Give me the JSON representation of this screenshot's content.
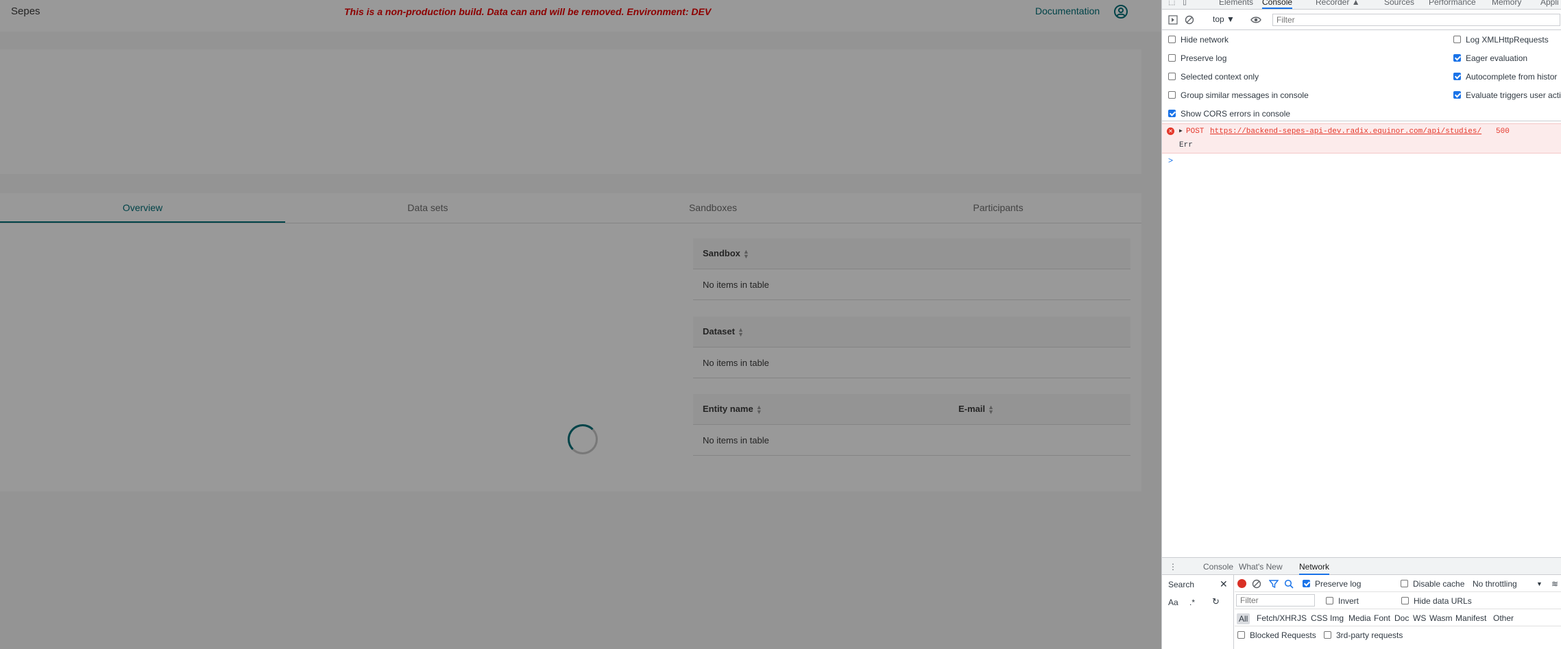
{
  "app": {
    "brand": "Sepes",
    "env_warning": "This is a non-production build. Data can and will be removed. Environment: DEV",
    "documentation_link": "Documentation",
    "tabs": [
      "Overview",
      "Data sets",
      "Sandboxes",
      "Participants"
    ],
    "active_tab": "Overview",
    "tables": [
      {
        "columns": [
          "Sandbox"
        ],
        "empty_text": "No items in table"
      },
      {
        "columns": [
          "Dataset"
        ],
        "empty_text": "No items in table"
      },
      {
        "columns": [
          "Entity name",
          "E-mail"
        ],
        "empty_text": "No items in table"
      }
    ],
    "accent_color": "#007079",
    "warning_color": "#eb0000"
  },
  "devtools": {
    "tabs": [
      "Elements",
      "Console",
      "Recorder ▲",
      "Sources",
      "Performance",
      "Memory",
      "Appli"
    ],
    "active_tab": "Console",
    "context": "top ▼",
    "filter_placeholder": "Filter",
    "settings_left": [
      {
        "label": "Hide network",
        "checked": false
      },
      {
        "label": "Preserve log",
        "checked": false
      },
      {
        "label": "Selected context only",
        "checked": false
      },
      {
        "label": "Group similar messages in console",
        "checked": false
      },
      {
        "label": "Show CORS errors in console",
        "checked": true
      }
    ],
    "settings_right": [
      {
        "label": "Log XMLHttpRequests",
        "checked": false
      },
      {
        "label": "Eager evaluation",
        "checked": true
      },
      {
        "label": "Autocomplete from histor",
        "checked": true
      },
      {
        "label": "Evaluate triggers user acti",
        "checked": true
      }
    ],
    "error": {
      "method": "POST",
      "url": "https://backend-sepes-api-dev.radix.equinor.com/api/studies/",
      "status": "500",
      "text": "Err"
    },
    "prompt": ">",
    "drawer": {
      "tabs": [
        "Console",
        "What's New",
        "Network"
      ],
      "active_tab": "Network",
      "search_label": "Search",
      "case_toggle": "Aa",
      "regex_toggle": ".*",
      "preserve_log": {
        "label": "Preserve log",
        "checked": true
      },
      "disable_cache": {
        "label": "Disable cache",
        "checked": false
      },
      "throttling": "No throttling",
      "filter_placeholder": "Filter",
      "invert": {
        "label": "Invert",
        "checked": false
      },
      "hide_data_urls": {
        "label": "Hide data URLs",
        "checked": false
      },
      "types": [
        "All",
        "Fetch/XHR",
        "JS",
        "CSS",
        "Img",
        "Media",
        "Font",
        "Doc",
        "WS",
        "Wasm",
        "Manifest",
        "Other"
      ],
      "blocked_requests": {
        "label": "Blocked Requests",
        "checked": false
      },
      "third_party": {
        "label": "3rd-party requests",
        "checked": false
      }
    }
  }
}
